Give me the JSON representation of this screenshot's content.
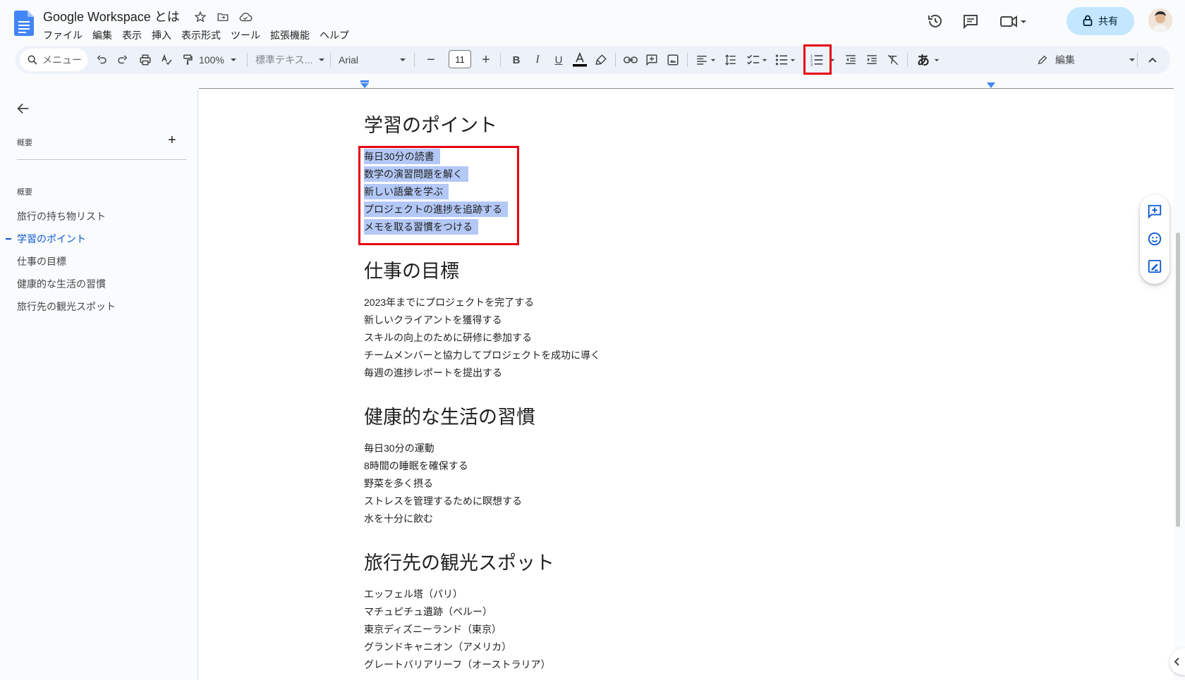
{
  "app": {
    "title": "Google Workspace とは",
    "menus": [
      "ファイル",
      "編集",
      "表示",
      "挿入",
      "表示形式",
      "ツール",
      "拡張機能",
      "ヘルプ"
    ],
    "share_label": "共有"
  },
  "toolbar": {
    "search_placeholder": "メニュー",
    "zoom": "100%",
    "style": "標準テキス...",
    "font": "Arial",
    "font_size": "11",
    "input_tool": "あ",
    "mode": "編集"
  },
  "outline": {
    "header": "概要",
    "section_label": "概要",
    "items": [
      "旅行の持ち物リスト",
      "学習のポイント",
      "仕事の目標",
      "健康的な生活の習慣",
      "旅行先の観光スポット"
    ],
    "active_index": 1
  },
  "document": {
    "sections": [
      {
        "heading": "学習のポイント",
        "items": [
          "毎日30分の読書",
          "数学の演習問題を解く",
          "新しい語彙を学ぶ",
          "プロジェクトの進捗を追跡する",
          "メモを取る習慣をつける"
        ],
        "selected": true
      },
      {
        "heading": "仕事の目標",
        "items": [
          "2023年までにプロジェクトを完了する",
          "新しいクライアントを獲得する",
          "スキルの向上のために研修に参加する",
          "チームメンバーと協力してプロジェクトを成功に導く",
          "毎週の進捗レポートを提出する"
        ],
        "selected": false
      },
      {
        "heading": "健康的な生活の習慣",
        "items": [
          "毎日30分の運動",
          "8時間の睡眠を確保する",
          "野菜を多く摂る",
          "ストレスを管理するために瞑想する",
          "水を十分に飲む"
        ],
        "selected": false
      },
      {
        "heading": "旅行先の観光スポット",
        "items": [
          "エッフェル塔（パリ）",
          "マチュピチュ遺跡（ペルー）",
          "東京ディズニーランド（東京）",
          "グランドキャニオン（アメリカ）",
          "グレートバリアリーフ（オーストラリア）"
        ],
        "selected": false
      }
    ]
  },
  "colors": {
    "accent": "#0b57d0",
    "selection": "#b3c8f6",
    "annotation_red": "#e60012",
    "share_bg": "#c2e7ff"
  },
  "icons": [
    "docs-logo-icon",
    "star-icon",
    "move-folder-icon",
    "cloud-saved-icon",
    "history-icon",
    "comments-icon",
    "meet-icon",
    "lock-icon",
    "search-icon",
    "undo-icon",
    "redo-icon",
    "print-icon",
    "spellcheck-icon",
    "paint-format-icon",
    "bold-icon",
    "italic-icon",
    "underline-icon",
    "text-color-icon",
    "highlight-icon",
    "link-icon",
    "add-comment-icon",
    "image-icon",
    "align-icon",
    "line-spacing-icon",
    "checklist-icon",
    "bulleted-list-icon",
    "numbered-list-icon",
    "decrease-indent-icon",
    "increase-indent-icon",
    "clear-format-icon",
    "pencil-icon",
    "collapse-icon",
    "back-arrow-icon",
    "emoji-icon",
    "suggest-edit-icon"
  ]
}
